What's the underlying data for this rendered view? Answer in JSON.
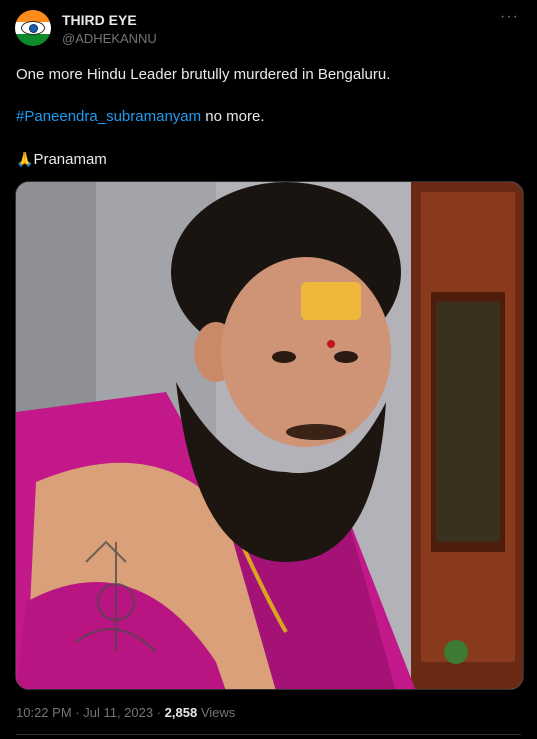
{
  "author": {
    "name": "THIRD EYE",
    "handle": "@ADHEKANNU",
    "avatar_icon": "third-eye-avatar"
  },
  "more_icon": "ellipsis-icon",
  "tweet": {
    "line1": "One more Hindu Leader brutully murdered in Bengaluru.",
    "hashtag": "#Paneendra_subramanyam",
    "line2_rest": " no more.",
    "folded_hands_emoji": "🙏",
    "line3": "Pranamam"
  },
  "meta": {
    "time": "10:22 PM",
    "sep1": " · ",
    "date": "Jul 11, 2023",
    "sep2": " · ",
    "views_count": "2,858",
    "views_label": " Views"
  },
  "colors": {
    "background": "#000000",
    "text": "#e7e9ea",
    "secondary": "#71767b",
    "link": "#1d9bf0",
    "robe_magenta": "#c2188a"
  }
}
